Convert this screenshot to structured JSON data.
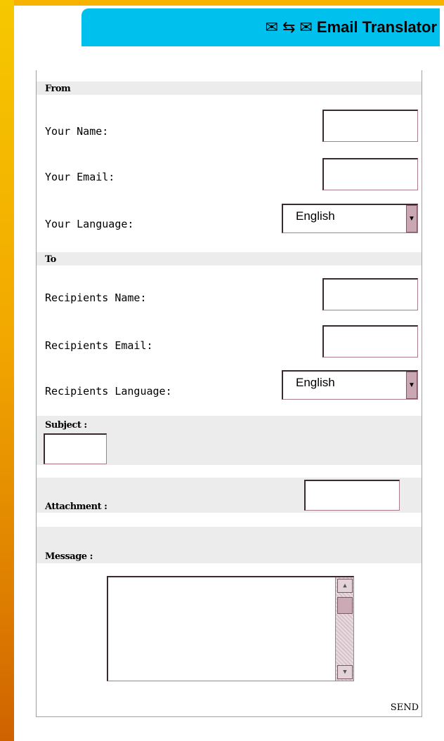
{
  "header": {
    "icon_left": "✉",
    "icon_swap": "⇆",
    "icon_right": "✉",
    "title": "Email Translator"
  },
  "from": {
    "section_label": "From",
    "name_label": "Your Name:",
    "email_label": "Your Email:",
    "language_label": "Your Language:",
    "language_value": "English"
  },
  "to": {
    "section_label": "To",
    "name_label": "Recipients Name:",
    "email_label": "Recipients Email:",
    "language_label": "Recipients Language:",
    "language_value": "English"
  },
  "subject": {
    "label": "Subject :"
  },
  "attachment": {
    "label": "Attachment :"
  },
  "message": {
    "label": "Message :"
  },
  "actions": {
    "send_label": "SEND"
  },
  "colors": {
    "header_bg": "#00c0ee",
    "left_bar": "#f2a800",
    "field_border": "#a87c8c",
    "band_bg": "#ececec"
  }
}
